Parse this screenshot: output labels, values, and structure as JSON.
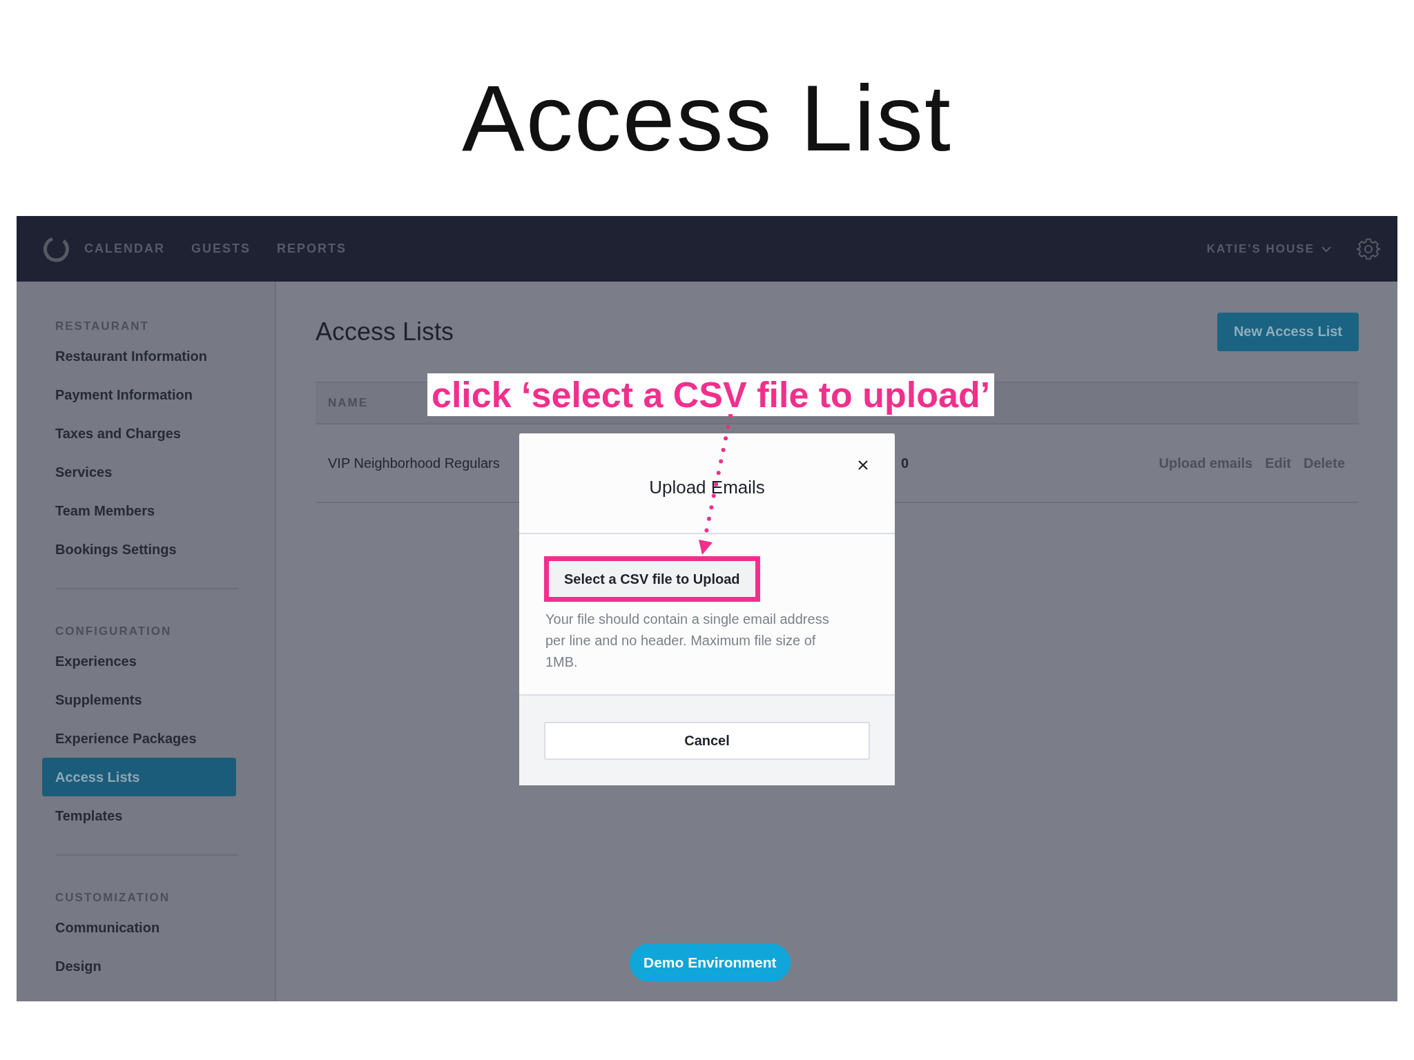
{
  "slide_title": "Access List",
  "nav": {
    "items": [
      {
        "label": "CALENDAR",
        "selected": false
      },
      {
        "label": "GUESTS",
        "selected": false
      },
      {
        "label": "REPORTS",
        "selected": false
      }
    ],
    "venue": "KATIE'S HOUSE"
  },
  "sidebar": {
    "sections": [
      {
        "heading": "RESTAURANT",
        "items": [
          {
            "label": "Restaurant Information",
            "selected": false
          },
          {
            "label": "Payment Information",
            "selected": false
          },
          {
            "label": "Taxes and Charges",
            "selected": false
          },
          {
            "label": "Services",
            "selected": false
          },
          {
            "label": "Team Members",
            "selected": false
          },
          {
            "label": "Bookings Settings",
            "selected": false
          }
        ]
      },
      {
        "heading": "CONFIGURATION",
        "items": [
          {
            "label": "Experiences",
            "selected": false
          },
          {
            "label": "Supplements",
            "selected": false
          },
          {
            "label": "Experience Packages",
            "selected": false
          },
          {
            "label": "Access Lists",
            "selected": true
          },
          {
            "label": "Templates",
            "selected": false
          }
        ]
      },
      {
        "heading": "CUSTOMIZATION",
        "items": [
          {
            "label": "Communication",
            "selected": false
          },
          {
            "label": "Design",
            "selected": false
          }
        ]
      }
    ]
  },
  "page": {
    "title": "Access Lists",
    "new_button": "New Access List",
    "table": {
      "columns": [
        "NAME"
      ],
      "rows": [
        {
          "name": "VIP Neighborhood Regulars",
          "count": "0",
          "actions": [
            "Upload emails",
            "Edit",
            "Delete"
          ]
        }
      ]
    }
  },
  "modal": {
    "title": "Upload Emails",
    "select_button": "Select a CSV file to Upload",
    "help": "Your file should contain a single email address per line and no header. Maximum file size of 1MB.",
    "cancel": "Cancel"
  },
  "annotation": {
    "text": "click ‘select a CSV file to upload’"
  },
  "badge": "Demo Environment"
}
